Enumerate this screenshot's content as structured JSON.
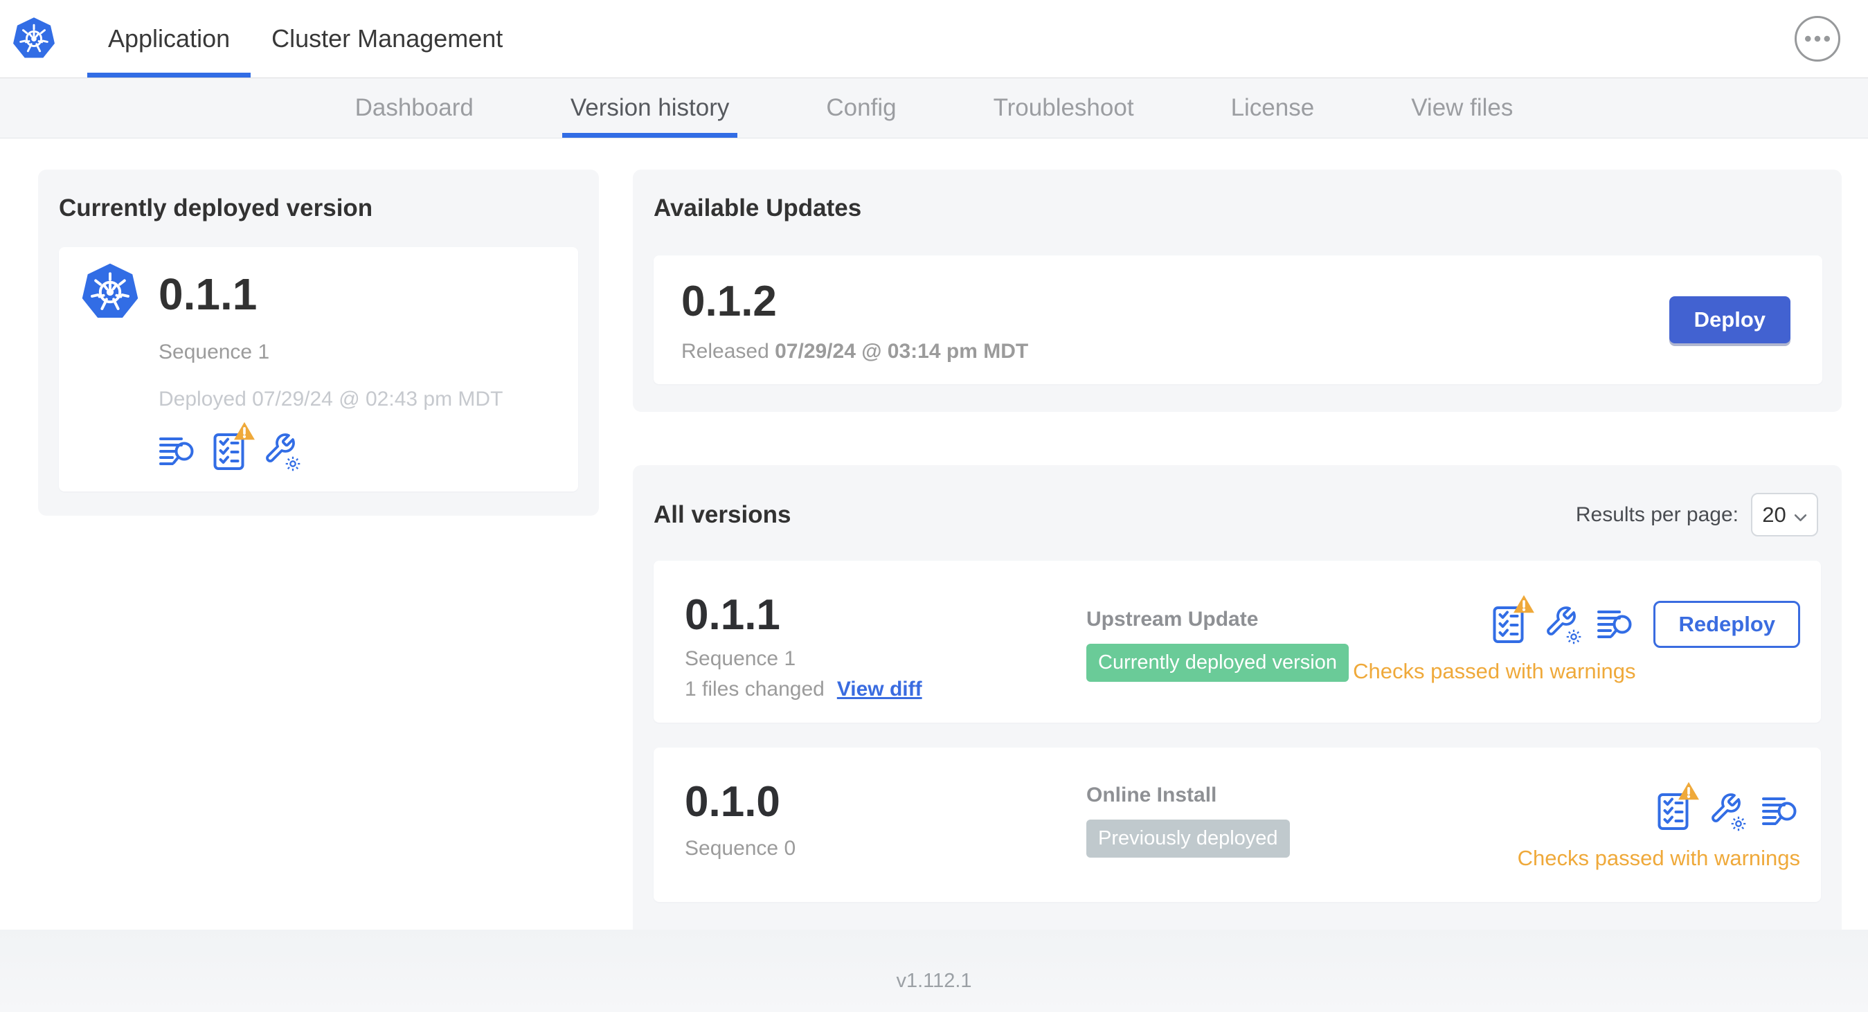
{
  "colors": {
    "accent_blue": "#326de5",
    "button_blue": "#4262d1",
    "link_blue": "#3a6ce0",
    "green_badge": "#6acb98",
    "gray_badge": "#c0c9cd",
    "warning_orange": "#efa93a",
    "card_bg": "#f5f6f8",
    "text_dark": "#323232",
    "text_gray": "#9b9b9b",
    "text_light": "#c6c9ce"
  },
  "header": {
    "tabs": [
      {
        "label": "Application"
      },
      {
        "label": "Cluster Management"
      }
    ],
    "active_tab": "Application",
    "overflow_icon": "ellipsis-menu-icon",
    "logo_icon": "kubernetes-logo-icon"
  },
  "subnav": {
    "tabs": [
      "Dashboard",
      "Version history",
      "Config",
      "Troubleshoot",
      "License",
      "View files"
    ],
    "active_tab": "Version history"
  },
  "currently_deployed": {
    "title": "Currently deployed version",
    "version": "0.1.1",
    "sequence": "Sequence 1",
    "deployed": "Deployed 07/29/24 @ 02:43 pm MDT",
    "icons": [
      "view-logs-icon",
      "preflight-checks-warning-icon",
      "edit-config-icon"
    ]
  },
  "available_updates": {
    "title": "Available Updates",
    "version": "0.1.2",
    "released_label": "Released",
    "released_date": "07/29/24 @ 03:14 pm MDT",
    "deploy_button": "Deploy"
  },
  "all_versions": {
    "title": "All versions",
    "results_per_page_label": "Results per page:",
    "results_per_page_value": "20",
    "rows": [
      {
        "version": "0.1.1",
        "sequence": "Sequence 1",
        "files_changed": "1 files changed",
        "view_diff_link": "View diff",
        "source": "Upstream Update",
        "status_badge": "Currently deployed version",
        "badge_style": "green",
        "checks_status": "Checks passed with warnings",
        "action_button": "Redeploy",
        "icons": [
          "preflight-checks-warning-icon",
          "edit-config-icon",
          "view-logs-icon"
        ]
      },
      {
        "version": "0.1.0",
        "sequence": "Sequence 0",
        "source": "Online Install",
        "status_badge": "Previously deployed",
        "badge_style": "gray",
        "checks_status": "Checks passed with warnings",
        "icons": [
          "preflight-checks-warning-icon",
          "edit-config-icon",
          "view-logs-icon"
        ]
      }
    ]
  },
  "footer": {
    "app_version": "v1.112.1"
  }
}
